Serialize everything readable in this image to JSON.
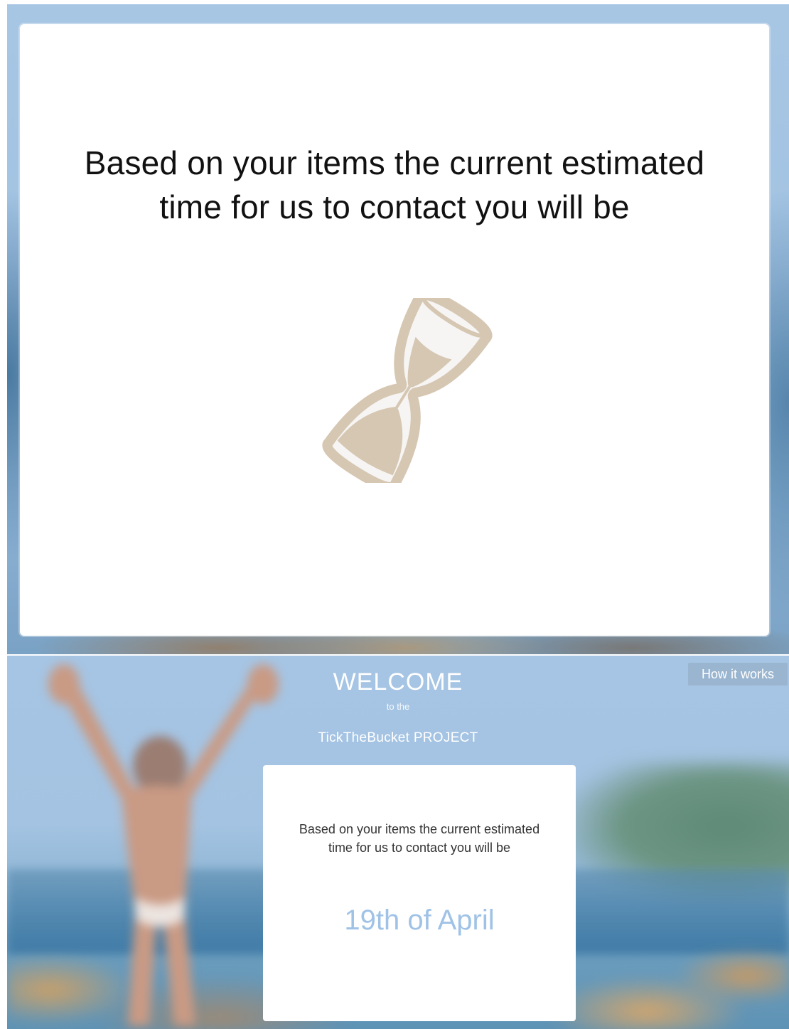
{
  "screen_loading": {
    "message_line1": "Based on your items the current estimated",
    "message_line2": "time for us to contact you will be",
    "icon": "hourglass-icon"
  },
  "screen_result": {
    "title": "WELCOME",
    "subtitle": "to the",
    "project_name": "TickTheBucket PROJECT",
    "how_it_works_label": "How it works",
    "message_line1": "Based on your items the current estimated",
    "message_line2": "time for us to contact you will be",
    "estimated_date": "19th of April"
  },
  "colors": {
    "sky_blue": "#a6c5e4",
    "date_blue": "#9fc2e6",
    "hourglass_tan": "#d6c7b3"
  }
}
